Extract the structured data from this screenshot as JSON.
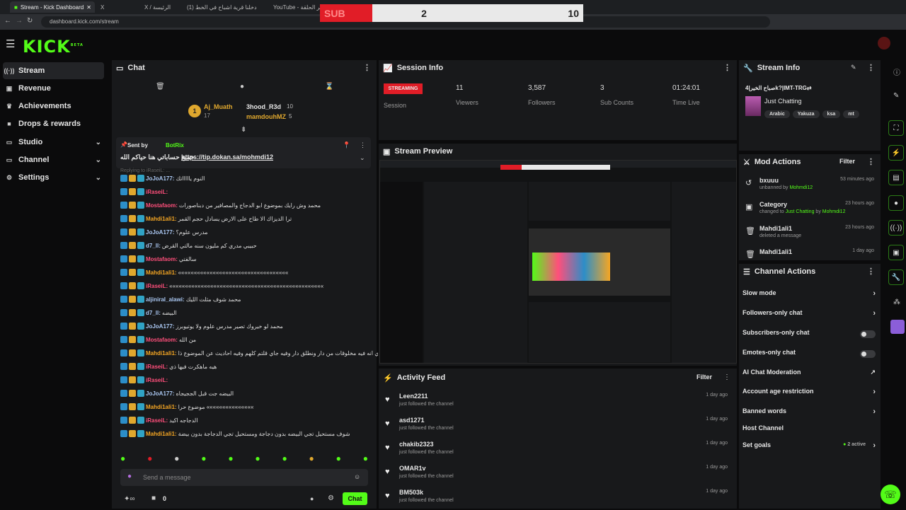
{
  "browser": {
    "tabs": [
      {
        "label": "Stream - Kick Dashboard"
      },
      {
        "label": "X"
      },
      {
        "label": "X / الرئيسة"
      },
      {
        "label": "(1) دخلنا قرية اشباح في الخط"
      },
      {
        "label": "YouTube - تم نشر الحلقة"
      }
    ],
    "url": "dashboard.kick.com/stream"
  },
  "overlay": {
    "sub_label": "SUB",
    "score_left": "2",
    "score_right": "10"
  },
  "brand": {
    "logo": "KICK",
    "beta": "BETA"
  },
  "sidebar": {
    "items": [
      {
        "label": "Stream",
        "icon": "broadcast-icon"
      },
      {
        "label": "Revenue",
        "icon": "wallet-icon"
      },
      {
        "label": "Achievements",
        "icon": "trophy-icon"
      },
      {
        "label": "Drops & rewards",
        "icon": "gift-icon"
      },
      {
        "label": "Studio",
        "icon": "tv-icon"
      },
      {
        "label": "Channel",
        "icon": "tv-icon"
      },
      {
        "label": "Settings",
        "icon": "gear-icon"
      }
    ]
  },
  "chat": {
    "title": "Chat",
    "leaderboard": {
      "rank": "1",
      "first": {
        "name": "Aj_Muath",
        "count": "17"
      },
      "second": {
        "name": "3hood_R3d",
        "count": "10"
      },
      "third": {
        "name": "mamdouhMZ",
        "count": "5"
      }
    },
    "pinned": {
      "sent_by": "Sent by",
      "author": "BotRix",
      "text": "جميع حساباتي هنا حياكم الله",
      "link": "https://tip.dokan.sa/mohmdi12"
    },
    "replying": "Replying to iRaseiL: ...",
    "messages": [
      {
        "user": "JoJoA177:",
        "text": "النوم ياااااتك",
        "color": "#a9c6f0"
      },
      {
        "user": "iRaseiL:",
        "text": "",
        "color": "#ff4f7b"
      },
      {
        "user": "Mostafaom:",
        "text": "محمد وش رايك بموضوع ابو الدجاج والمصافير من دبناصورات",
        "color": "#ff4f7b"
      },
      {
        "user": "Mahdi1ali1:",
        "text": "ترا الديزاك الا طاح على الارض يسادل حجم القمر",
        "color": "#f5a623"
      },
      {
        "user": "JoJoA177:",
        "text": "مدرس علوم؟",
        "color": "#a9c6f0"
      },
      {
        "user": "d7_ll:",
        "text": "حبيبي مدري كم مليون سنه مالتي القرض",
        "color": "#a9c6f0"
      },
      {
        "user": "Mostafaom:",
        "text": "سالفتي",
        "color": "#ff4f7b"
      },
      {
        "user": "Mahdi1ali1:",
        "text": "«««««««««««««««««««««««««««««««««««",
        "color": "#f5a623"
      },
      {
        "user": "iRaseiL:",
        "text": "«««««««««««««««««««««««««««««««««««««««««««««««««",
        "color": "#ff4f7b"
      },
      {
        "user": "aljiniral_alawi:",
        "text": "محمد شوف مثلت الليك",
        "color": "#a9c6f0"
      },
      {
        "user": "d7_ll:",
        "text": "البيضه",
        "color": "#a9c6f0"
      },
      {
        "user": "JoJoA177:",
        "text": "محمد لو خيروك تصير مدرس علوم ولا يوتيوبرز",
        "color": "#a9c6f0"
      },
      {
        "user": "Mostafaom:",
        "text": "من الله",
        "color": "#ff4f7b"
      },
      {
        "user": "Mahdi1ali1:",
        "text": "زين تدري انه فيه مخلوقات من دار ونطلق دار وفيه جاي قلتم كلهم وفيه احاديث عن الموضوع ذا",
        "color": "#f5a623"
      },
      {
        "user": "iRaseiL:",
        "text": "هيه ماهكرت فيها ذي",
        "color": "#ff4f7b"
      },
      {
        "user": "iRaseiL:",
        "text": "",
        "color": "#ff4f7b"
      },
      {
        "user": "JoJoA177:",
        "text": "البيضه جت قبل الججيجاه",
        "color": "#a9c6f0"
      },
      {
        "user": "Mahdi1ali1:",
        "text": "موضوع حرا «««««««««««««««",
        "color": "#f5a623"
      },
      {
        "user": "iRaseiL:",
        "text": "الدجاجه اكيد",
        "color": "#ff4f7b"
      },
      {
        "user": "Mahdi1ali1:",
        "text": "شوف مستحيل تجي البيضه بدون دجاجة ومستحيل تجي الدجاجة بدون بيضة",
        "color": "#f5a623"
      }
    ],
    "input_placeholder": "Send a message",
    "points": "0",
    "send_label": "Chat"
  },
  "session": {
    "title": "Session Info",
    "status": "STREAMING",
    "session_label": "Session",
    "viewers": {
      "value": "11",
      "label": "Viewers"
    },
    "followers": {
      "value": "3,587",
      "label": "Followers"
    },
    "subs": {
      "value": "3",
      "label": "Sub Counts"
    },
    "time": {
      "value": "01:24:01",
      "label": "Time Live"
    }
  },
  "preview": {
    "title": "Stream Preview"
  },
  "activity": {
    "title": "Activity Feed",
    "filter": "Filter",
    "items": [
      {
        "name": "Leen2211",
        "desc": "just followed the channel",
        "time": "1 day ago"
      },
      {
        "name": "asd1271",
        "desc": "just followed the channel",
        "time": "1 day ago"
      },
      {
        "name": "chakib2323",
        "desc": "just followed the channel",
        "time": "1 day ago"
      },
      {
        "name": "OMAR1v",
        "desc": "just followed the channel",
        "time": "1 day ago"
      },
      {
        "name": "BM503k",
        "desc": "just followed the channel",
        "time": "1 day ago"
      }
    ]
  },
  "stream_info": {
    "title": "Stream Info",
    "stream_title": "صباح الخير|4k?|IMT-TRG⇄",
    "category": "Just Chatting",
    "tags": [
      "Arabic",
      "Yakuza",
      "ksa",
      "mt"
    ]
  },
  "mod_actions": {
    "title": "Mod Actions",
    "filter": "Filter",
    "items": [
      {
        "name": "bxuuu",
        "desc": "unbanned by",
        "by": "Mohmdi12",
        "time": "53 minutes ago"
      },
      {
        "name": "Category",
        "desc": "changed to",
        "target": "Just Chatting",
        "by_word": "by",
        "by": "Mohmdi12",
        "time": "23 hours ago"
      },
      {
        "name": "Mahdi1ali1",
        "desc": "deleted a message",
        "time": "23 hours ago"
      },
      {
        "name": "Mahdi1ali1",
        "desc": "",
        "time": "1 day ago"
      }
    ]
  },
  "channel_actions": {
    "title": "Channel Actions",
    "rows": [
      {
        "label": "Slow mode"
      },
      {
        "label": "Followers-only chat"
      },
      {
        "label": "Subscribers-only chat"
      },
      {
        "label": "Emotes-only chat"
      },
      {
        "label": "AI Chat Moderation"
      },
      {
        "label": "Account age restriction"
      },
      {
        "label": "Banned words"
      },
      {
        "label": "Host Channel"
      },
      {
        "label": "Set goals",
        "status": "2 active"
      }
    ]
  },
  "colors": {
    "accent": "#53fc18",
    "live": "#e11d27"
  }
}
